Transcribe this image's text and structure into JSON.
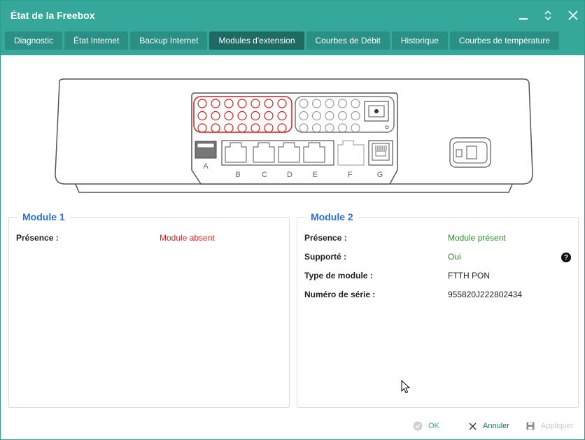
{
  "window": {
    "title": "État de la Freebox"
  },
  "titlebar": {
    "minimize_icon": "minimize-icon",
    "resize_icon": "updown-chevron-icon",
    "close_icon": "close-icon"
  },
  "tabs": [
    {
      "label": "Diagnostic",
      "active": false
    },
    {
      "label": "État Internet",
      "active": false
    },
    {
      "label": "Backup Internet",
      "active": false
    },
    {
      "label": "Modules d'extension",
      "active": true
    },
    {
      "label": "Courbes de Débit",
      "active": false
    },
    {
      "label": "Historique",
      "active": false
    },
    {
      "label": "Courbes de température",
      "active": false
    }
  ],
  "device": {
    "ports": [
      "A",
      "B",
      "C",
      "D",
      "E",
      "F",
      "G"
    ],
    "module1_color": "#d41c1c",
    "module2_color": "#9a9a9a"
  },
  "module1": {
    "title": "Module 1",
    "rows": [
      {
        "label": "Présence :",
        "value": "Module absent",
        "status": "red"
      }
    ]
  },
  "module2": {
    "title": "Module 2",
    "rows": [
      {
        "label": "Présence :",
        "value": "Module présent",
        "status": "green"
      },
      {
        "label": "Supporté :",
        "value": "Oui",
        "status": "green"
      },
      {
        "label": "Type de module :",
        "value": "FTTH PON",
        "status": "normal"
      },
      {
        "label": "Numéro de série :",
        "value": "955820J222802434",
        "status": "normal"
      }
    ],
    "help_icon": "?"
  },
  "footer": {
    "ok_label": "OK",
    "cancel_label": "Annuler",
    "apply_label": "Appliquer"
  },
  "colors": {
    "accent": "#35a89b",
    "tab": "#2a8f84",
    "tab_active": "#1f6b64",
    "title_blue": "#2a6fd6",
    "absent_red": "#e02020",
    "present_green": "#2a8a2a"
  }
}
